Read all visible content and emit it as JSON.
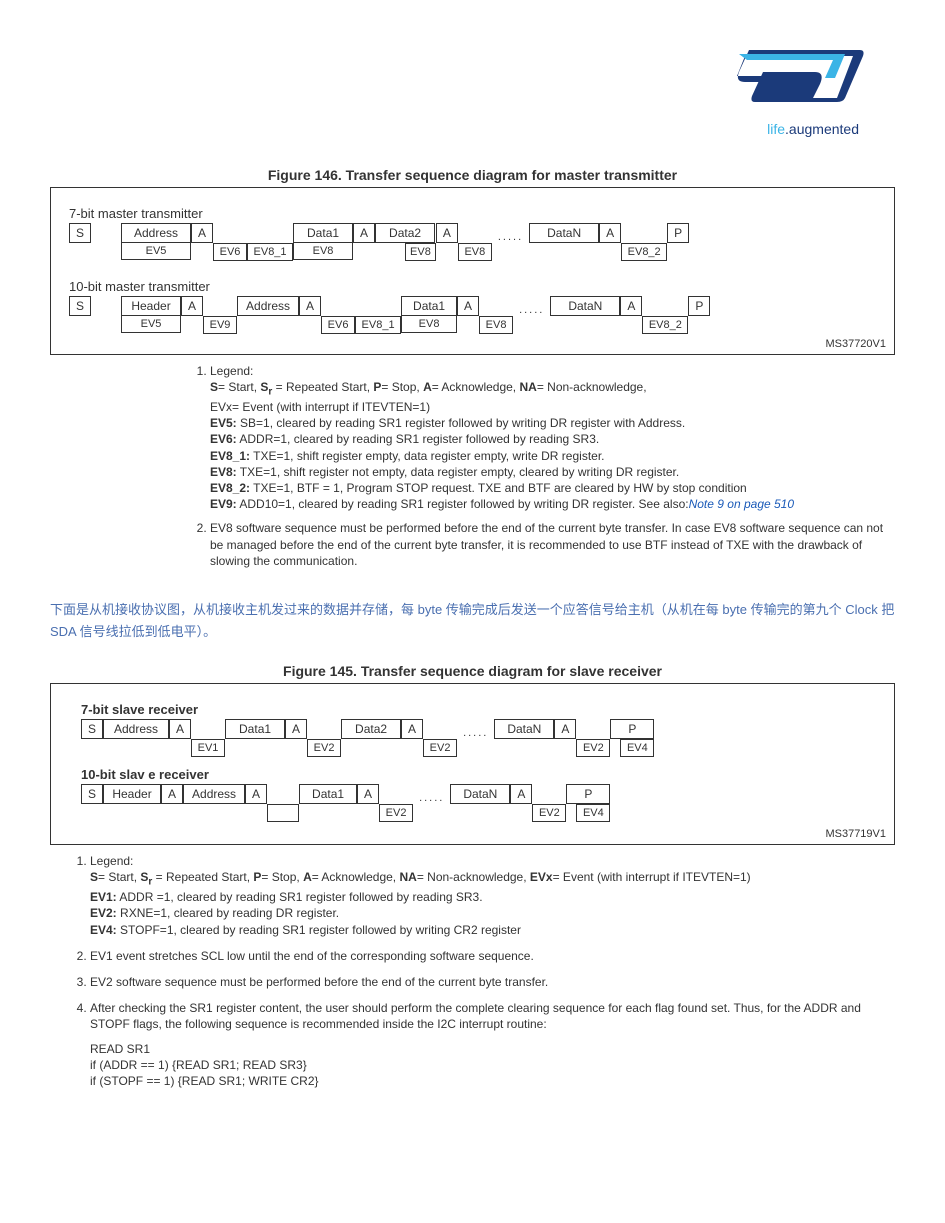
{
  "logo": {
    "company": "ST",
    "tagline_a": "life",
    "tagline_b": ".augmented"
  },
  "fig146": {
    "title": "Figure 146. Transfer sequence diagram for master transmitter",
    "label7": "7-bit master transmitter",
    "label10": "10-bit master transmitter",
    "code": "MS37720V1",
    "S": "S",
    "Address": "Address",
    "A": "A",
    "Data1": "Data1",
    "Data2": "Data2",
    "DataN": "DataN",
    "P": "P",
    "Header": "Header",
    "EV5": "EV5",
    "EV6": "EV6",
    "EV8_1": "EV8_1",
    "EV8": "EV8",
    "EV8_2": "EV8_2",
    "EV9": "EV9",
    "dots": "....."
  },
  "notes146": {
    "n1_head": "Legend:",
    "n1_l1a": "S",
    "n1_l1b": "= Start, ",
    "n1_l1c": "S",
    "n1_l1d": "r",
    "n1_l1e": " = Repeated Start, ",
    "n1_l1f": "P",
    "n1_l1g": "= Stop, ",
    "n1_l1h": "A",
    "n1_l1i": "= Acknowledge, ",
    "n1_l1j": "NA",
    "n1_l1k": "= Non-acknowledge,",
    "n1_l2": "EVx= Event (with interrupt if ITEVTEN=1)",
    "n1_ev5a": "EV5:",
    "n1_ev5b": " SB=1, cleared by reading SR1 register followed by writing DR register with Address.",
    "n1_ev6a": "EV6:",
    "n1_ev6b": " ADDR=1, cleared by reading SR1 register followed by reading SR3.",
    "n1_ev81a": "EV8_1:",
    "n1_ev81b": " TXE=1, shift register empty, data register empty, write DR register.",
    "n1_ev8a": "EV8:",
    "n1_ev8b": " TXE=1, shift register not empty, data register empty, cleared by writing DR register.",
    "n1_ev82a": "EV8_2:",
    "n1_ev82b": " TXE=1, BTF = 1, Program STOP request. TXE and BTF are cleared by HW by stop condition",
    "n1_ev9a": "EV9:",
    "n1_ev9b": " ADD10=1, cleared by reading SR1 register followed by writing DR register. See also:",
    "n1_ev9c": "Note 9 on page 510",
    "n2": "EV8 software sequence must be performed before the end of the current byte transfer. In case EV8 software sequence can not be managed before the end of the current byte transfer, it is recommended to use BTF instead of TXE with the drawback of slowing the communication."
  },
  "chinese": "下面是从机接收协议图，从机接收主机发过来的数据并存储，每 byte 传输完成后发送一个应答信号给主机（从机在每 byte 传输完的第九个 Clock 把 SDA 信号线拉低到低电平）。",
  "fig145": {
    "title": "Figure 145. Transfer sequence diagram for slave receiver",
    "label7": "7-bit slave receiver",
    "label10": "10-bit slav  e receiver",
    "code": "MS37719V1",
    "S": "S",
    "Address": "Address",
    "A": "A",
    "Data1": "Data1",
    "Data2": "Data2",
    "DataN": "DataN",
    "P": "P",
    "Header": "Header",
    "EV1": "EV1",
    "EV2": "EV2",
    "EV4": "EV4",
    "dots": "....."
  },
  "notes145": {
    "n1_head": "Legend:",
    "n1_l1a": "S",
    "n1_l1b": "= Start, ",
    "n1_l1c": "S",
    "n1_l1d": "r",
    "n1_l1e": " = Repeated Start, ",
    "n1_l1f": "P",
    "n1_l1g": "= Stop, ",
    "n1_l1h": "A",
    "n1_l1i": "= Acknowledge, ",
    "n1_l1j": "NA",
    "n1_l1k": "= Non-acknowledge, ",
    "n1_l1l": "EVx",
    "n1_l1m": "= Event (with interrupt if ITEVTEN=1)",
    "n1_ev1a": "EV1:",
    "n1_ev1b": " ADDR =1, cleared by reading SR1 register followed by reading SR3.",
    "n1_ev2a": "EV2:",
    "n1_ev2b": " RXNE=1, cleared by reading DR register.",
    "n1_ev4a": "EV4:",
    "n1_ev4b": " STOPF=1, cleared by reading SR1 register followed by writing CR2 register",
    "n2": "EV1 event stretches SCL low until the end of the corresponding software sequence.",
    "n3": "EV2 software sequence must be performed before the end of the current byte transfer.",
    "n4": "After checking the SR1 register content, the user should perform the complete clearing sequence for each flag found set. Thus, for the ADDR and STOPF flags, the following sequence is recommended inside the I2C interrupt routine:",
    "n4c1": "READ SR1",
    "n4c2": "if (ADDR == 1) {READ SR1; READ SR3}",
    "n4c3": "if (STOPF == 1) {READ SR1; WRITE CR2}"
  }
}
